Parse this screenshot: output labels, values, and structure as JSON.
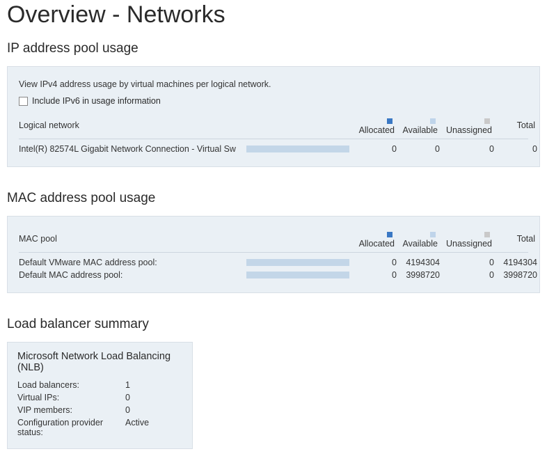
{
  "page": {
    "title": "Overview - Networks"
  },
  "ip_pool": {
    "section_title": "IP address pool usage",
    "description": "View IPv4 address usage by virtual machines per logical network.",
    "checkbox_label": "Include IPv6 in usage information",
    "headers": {
      "name": "Logical network",
      "allocated": "Allocated",
      "available": "Available",
      "unassigned": "Unassigned",
      "total": "Total"
    },
    "rows": [
      {
        "name": "Intel(R) 82574L Gigabit Network Connection - Virtual Sw",
        "allocated": "0",
        "available": "0",
        "unassigned": "0",
        "total": "0"
      }
    ]
  },
  "mac_pool": {
    "section_title": "MAC address pool usage",
    "headers": {
      "name": "MAC pool",
      "allocated": "Allocated",
      "available": "Available",
      "unassigned": "Unassigned",
      "total": "Total"
    },
    "rows": [
      {
        "name": "Default VMware MAC address pool:",
        "allocated": "0",
        "available": "4194304",
        "unassigned": "0",
        "total": "4194304"
      },
      {
        "name": "Default MAC address pool:",
        "allocated": "0",
        "available": "3998720",
        "unassigned": "0",
        "total": "3998720"
      }
    ]
  },
  "load_balancer": {
    "section_title": "Load balancer summary",
    "card_title": "Microsoft Network Load Balancing (NLB)",
    "items": [
      {
        "key": "Load balancers:",
        "val": "1"
      },
      {
        "key": "Virtual IPs:",
        "val": "0"
      },
      {
        "key": "VIP members:",
        "val": "0"
      },
      {
        "key": "Configuration provider status:",
        "val": "Active"
      }
    ]
  }
}
